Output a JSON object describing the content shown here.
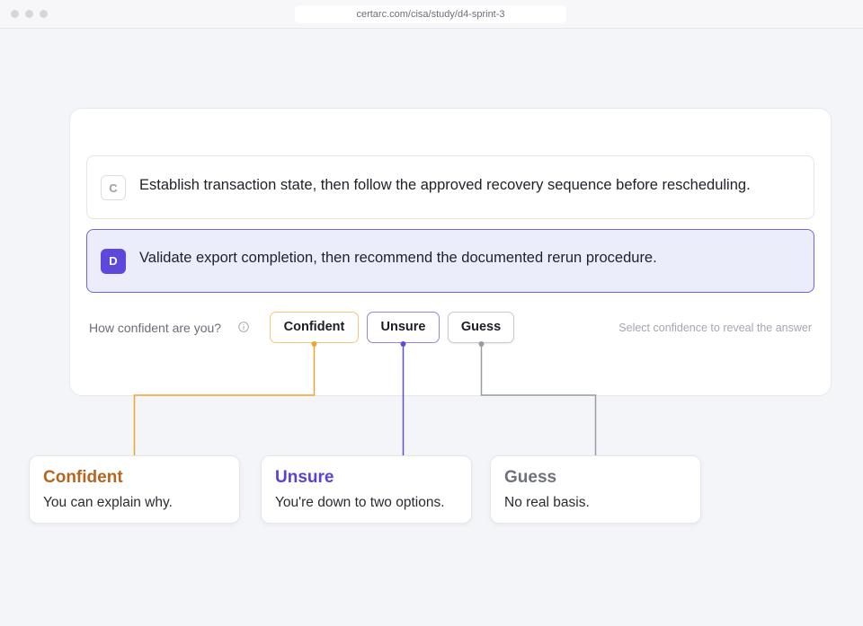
{
  "browser": {
    "url": "certarc.com/cisa/study/d4-sprint-3"
  },
  "options": [
    {
      "letter": "C",
      "text": "Establish transaction state, then follow the approved recovery sequence before rescheduling.",
      "selected": false
    },
    {
      "letter": "D",
      "text": "Validate export completion, then recommend the documented rerun procedure.",
      "selected": true
    }
  ],
  "confidence": {
    "prompt": "How confident are you?",
    "info_icon": "info-circle-icon",
    "buttons": {
      "confident": "Confident",
      "unsure": "Unsure",
      "guess": "Guess"
    },
    "hint": "Select confidence to reveal the answer"
  },
  "legend": {
    "confident": {
      "title": "Confident",
      "description": "You can explain why.",
      "color": "#b5651d"
    },
    "unsure": {
      "title": "Unsure",
      "description": "You're down to two options.",
      "color": "#5b3fd6"
    },
    "guess": {
      "title": "Guess",
      "description": "No real basis.",
      "color": "#6f727c"
    }
  },
  "colors": {
    "selected_accent": "#5b49dc",
    "confident_line": "#f0a52a",
    "unsure_line": "#5a4fd6",
    "guess_line": "#9a9ca4"
  }
}
